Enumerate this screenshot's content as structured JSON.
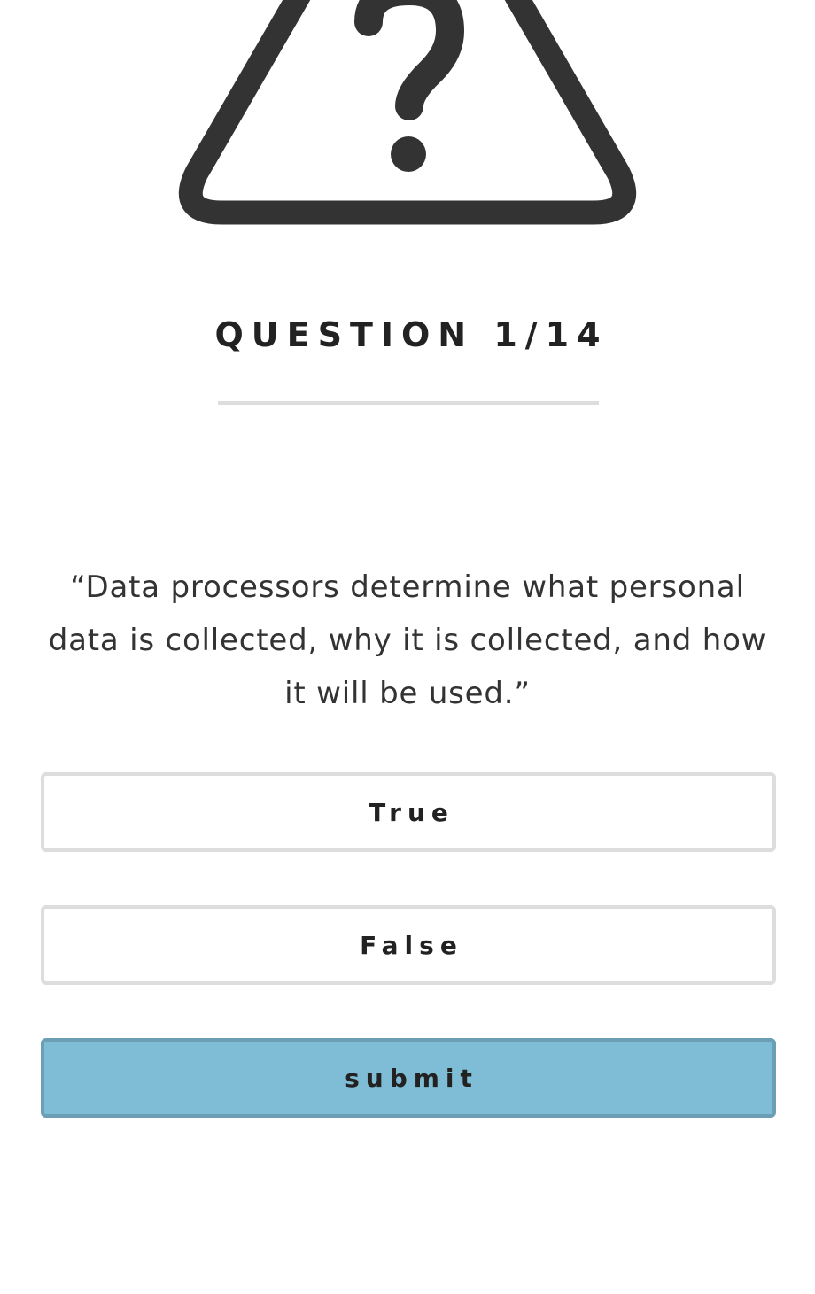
{
  "quiz": {
    "icon": "warning-question-icon",
    "question_label": "QUESTION 1/14",
    "question_text": "“Data processors determine what personal data is collected, why it is collected, and how it will be used.”",
    "options": [
      {
        "label": "True"
      },
      {
        "label": "False"
      }
    ],
    "submit_label": "submit"
  },
  "colors": {
    "icon": "#333333",
    "divider": "#dddddd",
    "option_border": "#dddddd",
    "submit_bg": "#7fbcd5",
    "submit_border": "#6a9fb5"
  }
}
